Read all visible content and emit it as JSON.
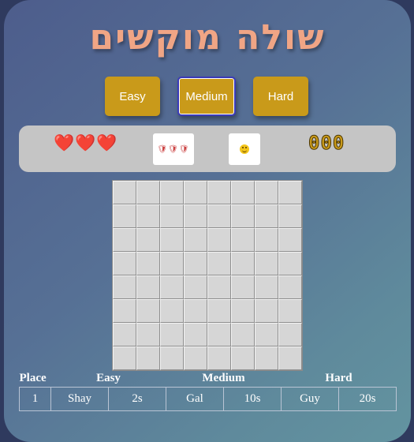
{
  "title": "שולה מוקשים",
  "levels": [
    {
      "label": "Easy",
      "selected": false
    },
    {
      "label": "Medium",
      "selected": true
    },
    {
      "label": "Hard",
      "selected": false
    }
  ],
  "status": {
    "lives": "❤️❤️❤️",
    "hints": "🛡🛡🛡",
    "smiley_icon": "smiley-face-icon",
    "mine_counter": "000"
  },
  "board": {
    "rows": 8,
    "cols": 8
  },
  "scoreboard": {
    "headers": {
      "place": "Place",
      "easy": "Easy",
      "medium": "Medium",
      "hard": "Hard"
    },
    "rows": [
      {
        "place": "1",
        "easy_name": "Shay",
        "easy_time": "2s",
        "medium_name": "Gal",
        "medium_time": "10s",
        "hard_name": "Guy",
        "hard_time": "20s"
      }
    ]
  },
  "colors": {
    "title": "#f0a585",
    "button": "#c99a1a",
    "status_bar": "#c5c5c5",
    "cell": "#d6d6d6"
  }
}
